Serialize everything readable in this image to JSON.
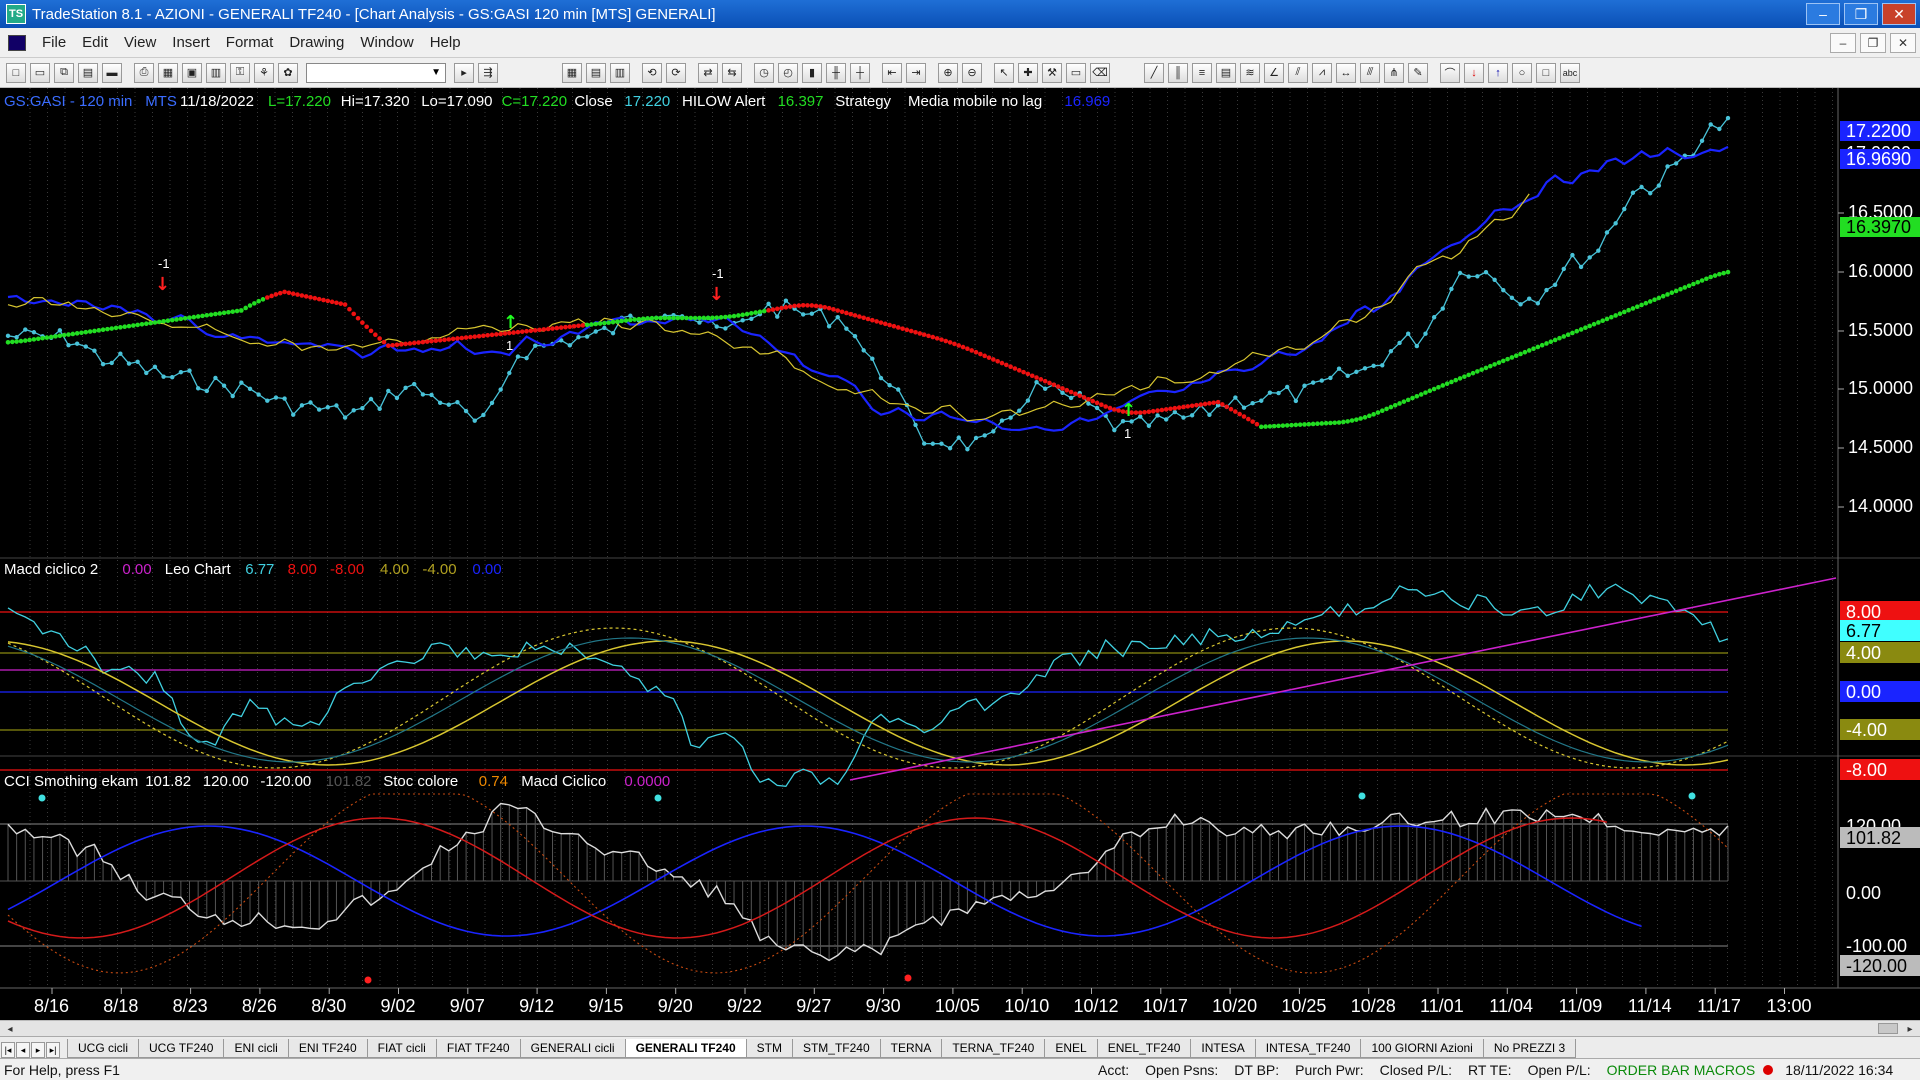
{
  "window": {
    "title": "TradeStation 8.1 - AZIONI - GENERALI TF240 - [Chart Analysis - GS:GASI  120 min  [MTS] GENERALI]",
    "minimize": "–",
    "maximize": "❐",
    "close": "✕"
  },
  "menu": [
    "File",
    "Edit",
    "View",
    "Insert",
    "Format",
    "Drawing",
    "Window",
    "Help"
  ],
  "mdi": {
    "minimize": "–",
    "restore": "❐",
    "close": "✕"
  },
  "toolbar": {
    "combo_value": "▼"
  },
  "chart": {
    "colors": {
      "background": "#000000",
      "price": "#49c3d9",
      "blue_ma": "#1a24ff",
      "yellow_ma": "#d8c630",
      "green_dots": "#22dd22",
      "red_dots": "#ee1111",
      "cyan": "#40d0e0",
      "magenta": "#cc22cc"
    },
    "price_panel": {
      "header": [
        {
          "text": "GS:GASI - 120 min",
          "color": "#3a6cff"
        },
        {
          "text": "MTS",
          "color": "#3a6cff"
        },
        {
          "text": "11/18/2022",
          "color": "#ffffff"
        },
        {
          "text": "L=17.220",
          "color": "#22dd22"
        },
        {
          "text": "Hi=17.320",
          "color": "#ffffff"
        },
        {
          "text": "Lo=17.090",
          "color": "#ffffff"
        },
        {
          "text": "C=17.220",
          "color": "#22dd22"
        },
        {
          "text": "Close",
          "color": "#ffffff"
        },
        {
          "text": "17.220",
          "color": "#40d0e0"
        },
        {
          "text": "HILOW Alert",
          "color": "#ffffff"
        },
        {
          "text": "16.397",
          "color": "#22dd22"
        },
        {
          "text": "Strategy",
          "color": "#ffffff"
        },
        {
          "text": "Media mobile no lag",
          "color": "#ffffff"
        },
        {
          "text": "16.969",
          "color": "#1a24ff"
        }
      ],
      "axis_labels": [
        "16.5000",
        "16.0000",
        "15.5000",
        "15.0000",
        "14.5000",
        "14.0000"
      ],
      "tags": [
        {
          "text": "17.2200",
          "bg": "#1a24ff",
          "fg": "#ffffff"
        },
        {
          "text": "17.0000",
          "bg": "#000000",
          "fg": "#ffffff"
        },
        {
          "text": "16.9690",
          "bg": "#1a24ff",
          "fg": "#ffffff"
        },
        {
          "text": "16.3970",
          "bg": "#22dd22",
          "fg": "#000000"
        }
      ],
      "markers": [
        {
          "label": "-1",
          "kind": "down"
        },
        {
          "label": "1",
          "kind": "up"
        },
        {
          "label": "-1",
          "kind": "down"
        },
        {
          "label": "1",
          "kind": "up"
        }
      ]
    },
    "macd_panel": {
      "header": [
        {
          "text": "Macd ciclico 2",
          "color": "#ffffff"
        },
        {
          "text": "0.00",
          "color": "#cc22cc"
        },
        {
          "text": "Leo Chart",
          "color": "#ffffff"
        },
        {
          "text": "6.77",
          "color": "#40d0e0"
        },
        {
          "text": "8.00",
          "color": "#ee1111"
        },
        {
          "text": "-8.00",
          "color": "#ee1111"
        },
        {
          "text": "4.00",
          "color": "#b0a020"
        },
        {
          "text": "-4.00",
          "color": "#b0a020"
        },
        {
          "text": "0.00",
          "color": "#1a24ff"
        }
      ],
      "tags": [
        {
          "text": "8.00",
          "bg": "#ee1111",
          "fg": "#ffffff"
        },
        {
          "text": "6.77",
          "bg": "#40ffff",
          "fg": "#000000"
        },
        {
          "text": "4.00",
          "bg": "#8a8a10",
          "fg": "#ffffff"
        },
        {
          "text": "0.00",
          "bg": "#1a24ff",
          "fg": "#ffffff"
        },
        {
          "text": "-4.00",
          "bg": "#8a8a10",
          "fg": "#ffffff"
        },
        {
          "text": "-8.00",
          "bg": "#ee1111",
          "fg": "#ffffff"
        }
      ]
    },
    "cci_panel": {
      "header": [
        {
          "text": "CCI Smothing ekam",
          "color": "#ffffff"
        },
        {
          "text": "101.82",
          "color": "#ffffff"
        },
        {
          "text": "120.00",
          "color": "#ffffff"
        },
        {
          "text": "-120.00",
          "color": "#ffffff"
        },
        {
          "text": "101.82",
          "color": "#555555"
        },
        {
          "text": "Stoc colore",
          "color": "#ffffff"
        },
        {
          "text": "0.74",
          "color": "#ee8800"
        },
        {
          "text": "Macd Ciclico",
          "color": "#ffffff"
        },
        {
          "text": "0.0000",
          "color": "#cc22cc"
        }
      ],
      "tags": [
        {
          "text": "120.00",
          "bg": "#000000",
          "fg": "#ffffff"
        },
        {
          "text": "101.82",
          "bg": "#bbbbbb",
          "fg": "#000000"
        },
        {
          "text": "0.00",
          "bg": "#000000",
          "fg": "#ffffff"
        },
        {
          "text": "-100.00",
          "bg": "#000000",
          "fg": "#ffffff"
        },
        {
          "text": "-120.00",
          "bg": "#bbbbbb",
          "fg": "#000000"
        }
      ]
    },
    "x_axis": [
      "8/16",
      "8/18",
      "8/23",
      "8/26",
      "8/30",
      "9/02",
      "9/07",
      "9/12",
      "9/15",
      "9/20",
      "9/22",
      "9/27",
      "9/30",
      "10/05",
      "10/10",
      "10/12",
      "10/17",
      "10/20",
      "10/25",
      "10/28",
      "11/01",
      "11/04",
      "11/09",
      "11/14",
      "11/17",
      "13:00"
    ]
  },
  "tabs": [
    "UCG cicli",
    "UCG TF240",
    "ENI cicli",
    "ENI TF240",
    "FIAT cicli",
    "FIAT TF240",
    "GENERALI cicli",
    "GENERALI TF240",
    "STM",
    "STM_TF240",
    "TERNA",
    "TERNA_TF240",
    "ENEL",
    "ENEL_TF240",
    "INTESA",
    "INTESA_TF240",
    "100 GIORNI Azioni",
    "No PREZZI 3"
  ],
  "active_tab": "GENERALI TF240",
  "status": {
    "help": "For Help, press F1",
    "cells": [
      "Acct:",
      "Open Psns:",
      "DT BP:",
      "Purch Pwr:",
      "Closed P/L:",
      "RT TE:",
      "Open P/L:"
    ],
    "order_bar": "ORDER BAR  MACROS",
    "datetime": "18/11/2022 16:34"
  }
}
